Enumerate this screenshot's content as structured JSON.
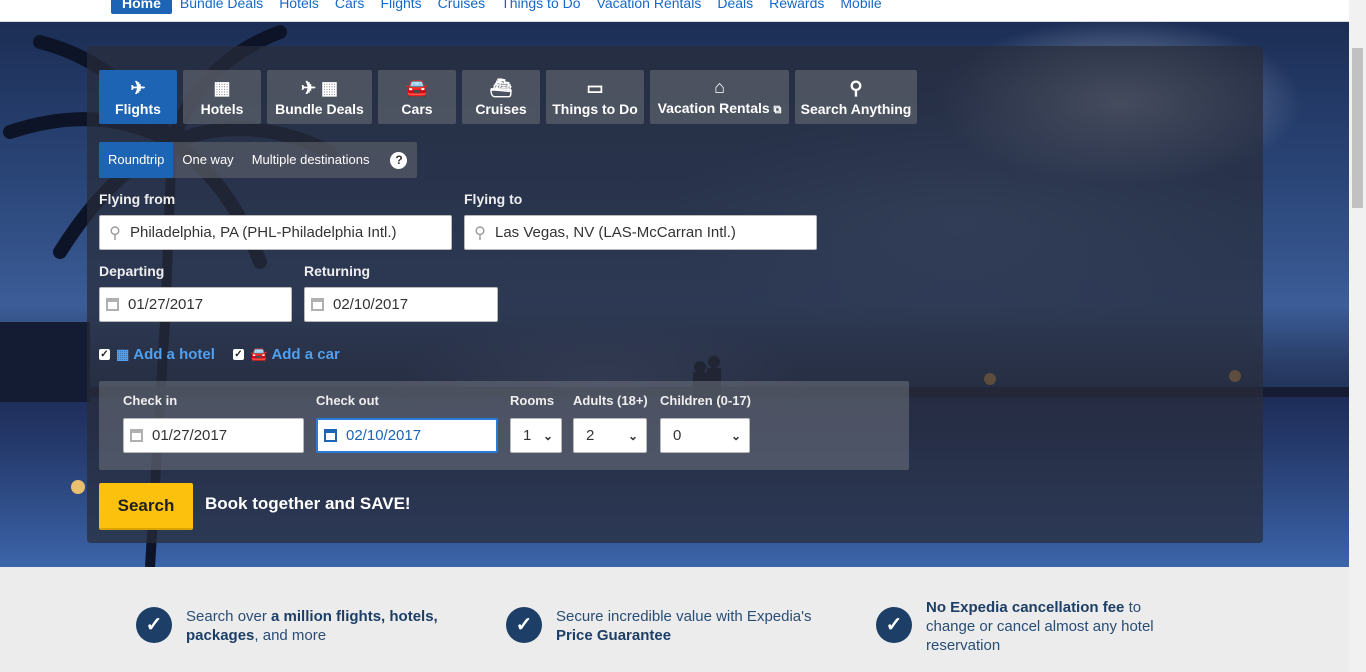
{
  "topnav": {
    "items": [
      "Home",
      "Bundle Deals",
      "Hotels",
      "Cars",
      "Flights",
      "Cruises",
      "Things to Do",
      "Vacation Rentals",
      "Deals",
      "Rewards",
      "Mobile"
    ]
  },
  "tabs": [
    {
      "label": "Flights",
      "icon": "plane-icon"
    },
    {
      "label": "Hotels",
      "icon": "building-icon"
    },
    {
      "label": "Bundle Deals",
      "icon": "plane-building-icon"
    },
    {
      "label": "Cars",
      "icon": "car-icon"
    },
    {
      "label": "Cruises",
      "icon": "ship-icon"
    },
    {
      "label": "Things to Do",
      "icon": "ticket-icon"
    },
    {
      "label": "Vacation Rentals",
      "icon": "house-icon"
    },
    {
      "label": "Search Anything",
      "icon": "search-icon"
    }
  ],
  "trip_types": {
    "roundtrip": "Roundtrip",
    "oneway": "One way",
    "multi": "Multiple destinations",
    "help": "?"
  },
  "flight": {
    "from_label": "Flying from",
    "from_value": "Philadelphia, PA (PHL-Philadelphia Intl.)",
    "to_label": "Flying to",
    "to_value": "Las Vegas, NV (LAS-McCarran Intl.)",
    "departing_label": "Departing",
    "departing_value": "01/27/2017",
    "returning_label": "Returning",
    "returning_value": "02/10/2017"
  },
  "addons": {
    "hotel": "Add a hotel",
    "car": "Add a car",
    "hotel_checked": true,
    "car_checked": true
  },
  "hotel": {
    "checkin_label": "Check in",
    "checkin_value": "01/27/2017",
    "checkout_label": "Check out",
    "checkout_value": "02/10/2017",
    "rooms_label": "Rooms",
    "rooms_value": "1",
    "adults_label": "Adults (18+)",
    "adults_value": "2",
    "children_label": "Children (0-17)",
    "children_value": "0"
  },
  "search_button": "Search",
  "promo": "Book together and SAVE!",
  "features": [
    {
      "pre": "Search over ",
      "bold": "a million flights, hotels, packages",
      "post": ", and more"
    },
    {
      "pre": "Secure incredible value with Expedia's ",
      "bold": "Price Guarantee",
      "post": ""
    },
    {
      "pre": "",
      "bold": "No Expedia cancellation fee",
      "post": " to change or cancel almost any hotel reservation"
    }
  ],
  "colors": {
    "accent": "#1e64b4",
    "search_button": "#fcc10c",
    "badge": "#1d3e66"
  }
}
